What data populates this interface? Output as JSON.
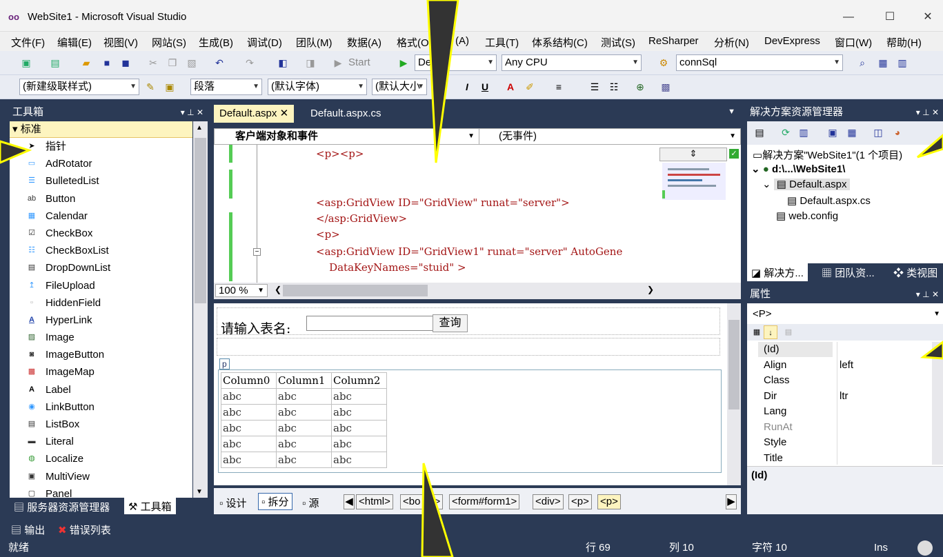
{
  "window": {
    "title": "WebSite1 - Microsoft Visual Studio",
    "logo": "oo",
    "min": "—",
    "max": "☐",
    "close": "✕"
  },
  "menu": [
    "文件(F)",
    "编辑(E)",
    "视图(V)",
    "网站(S)",
    "生成(B)",
    "调试(D)",
    "团队(M)",
    "数据(A)",
    "格式(O",
    "(A)",
    "工具(T)",
    "体系结构(C)",
    "测试(S)",
    "ReSharper",
    "分析(N)",
    "DevExpress",
    "窗口(W)",
    "帮助(H)"
  ],
  "toolbar1": {
    "start": "Start",
    "config": "De",
    "platform": "Any CPU",
    "connection": "connSql"
  },
  "toolbar2": {
    "style": "(新建级联样式)",
    "block": "段落",
    "font": "(默认字体)",
    "size": "(默认大小"
  },
  "toolbox": {
    "title": "工具箱",
    "category": "标准",
    "items": [
      "指针",
      "AdRotator",
      "BulletedList",
      "Button",
      "Calendar",
      "CheckBox",
      "CheckBoxList",
      "DropDownList",
      "FileUpload",
      "HiddenField",
      "HyperLink",
      "Image",
      "ImageButton",
      "ImageMap",
      "Label",
      "LinkButton",
      "ListBox",
      "Literal",
      "Localize",
      "MultiView",
      "Panel"
    ],
    "tab_server": "服务器资源管理器",
    "tab_toolbox": "工具箱"
  },
  "editor": {
    "tabs": [
      "Default.aspx",
      "Default.aspx.cs"
    ],
    "nav_object": "客户端对象和事件",
    "nav_event": "(无事件)",
    "code_lines": [
      "<p><p>",
      "",
      "<asp:GridView ID=\"GridView\" runat=\"server\">",
      "</asp:GridView>",
      "<p>",
      "",
      "<asp:GridView ID=\"GridView1\" runat=\"server\" AutoGene",
      "    DataKeyNames=\"stuid\" >"
    ],
    "zoom": "100 %",
    "design": {
      "label": "请输入表名:",
      "query_button": "查询",
      "p_tag": "p",
      "columns": [
        "Column0",
        "Column1",
        "Column2"
      ],
      "rows": [
        [
          "abc",
          "abc",
          "abc"
        ],
        [
          "abc",
          "abc",
          "abc"
        ],
        [
          "abc",
          "abc",
          "abc"
        ],
        [
          "abc",
          "abc",
          "abc"
        ],
        [
          "abc",
          "abc",
          "abc"
        ]
      ]
    },
    "views": [
      "设计",
      "拆分",
      "源"
    ],
    "crumbs": [
      "<html>",
      "<bo",
      "y>",
      "<form#form1>",
      "<div>",
      "<p>",
      "<p>"
    ]
  },
  "solution": {
    "title": "解决方案资源管理器",
    "root": "解决方案\"WebSite1\"(1 个项目)",
    "project": "d:\\...\\WebSite1\\",
    "file1": "Default.aspx",
    "file1_child": "Default.aspx.cs",
    "file2": "web.config",
    "tabs": [
      "解决方...",
      "团队资...",
      "类视图"
    ]
  },
  "properties": {
    "title": "属性",
    "object": "<P>",
    "rows": [
      {
        "k": "(Id)",
        "v": ""
      },
      {
        "k": "Align",
        "v": "left"
      },
      {
        "k": "Class",
        "v": ""
      },
      {
        "k": "Dir",
        "v": "ltr"
      },
      {
        "k": "Lang",
        "v": ""
      },
      {
        "k": "RunAt",
        "v": ""
      },
      {
        "k": "Style",
        "v": ""
      },
      {
        "k": "Title",
        "v": ""
      }
    ],
    "description": "(Id)"
  },
  "output_tabs": [
    "输出",
    "错误列表"
  ],
  "status": {
    "ready": "就绪",
    "row": "行 69",
    "col": "列 10",
    "char": "字符 10",
    "mode": "Ins"
  }
}
